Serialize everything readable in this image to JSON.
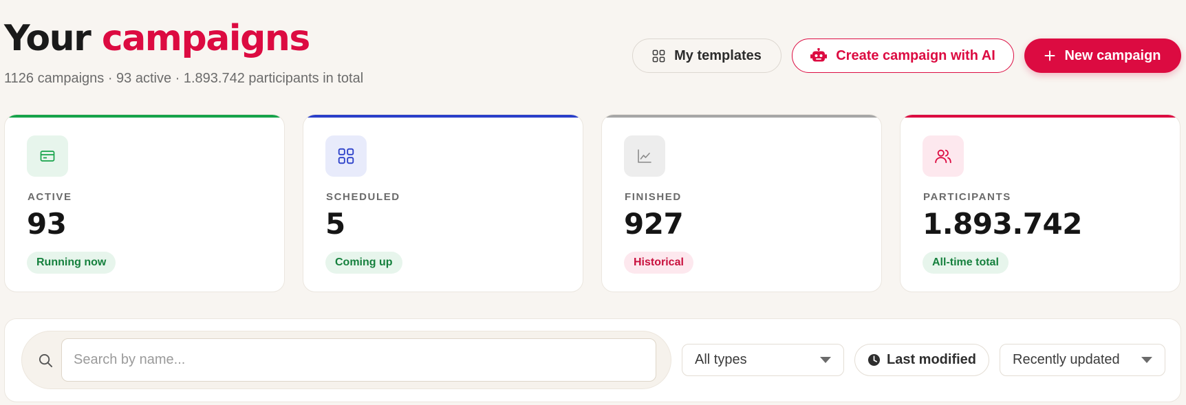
{
  "header": {
    "title_prefix": "Your",
    "title_accent": "campaigns",
    "summary": "1126 campaigns · 93 active · 1.893.742 participants in total"
  },
  "actions": {
    "templates_label": "My templates",
    "ai_label": "Create campaign with AI",
    "new_label": "New campaign"
  },
  "stats": [
    {
      "label": "ACTIVE",
      "value": "93",
      "badge": "Running now",
      "icon": "card-icon",
      "accent": "#16a34a"
    },
    {
      "label": "SCHEDULED",
      "value": "5",
      "badge": "Coming up",
      "icon": "grid-icon",
      "accent": "#2a3fc9"
    },
    {
      "label": "FINISHED",
      "value": "927",
      "badge": "Historical",
      "icon": "chart-icon",
      "accent": "#a6a6a6"
    },
    {
      "label": "PARTICIPANTS",
      "value": "1.893.742",
      "badge": "All-time total",
      "icon": "users-icon",
      "accent": "#dc0b41"
    }
  ],
  "filters": {
    "search_placeholder": "Search by name...",
    "type_select": "All types",
    "modified_chip": "Last modified",
    "sort_select": "Recently updated"
  },
  "colors": {
    "brand": "#dc0b41",
    "background": "#f8f5f1"
  }
}
